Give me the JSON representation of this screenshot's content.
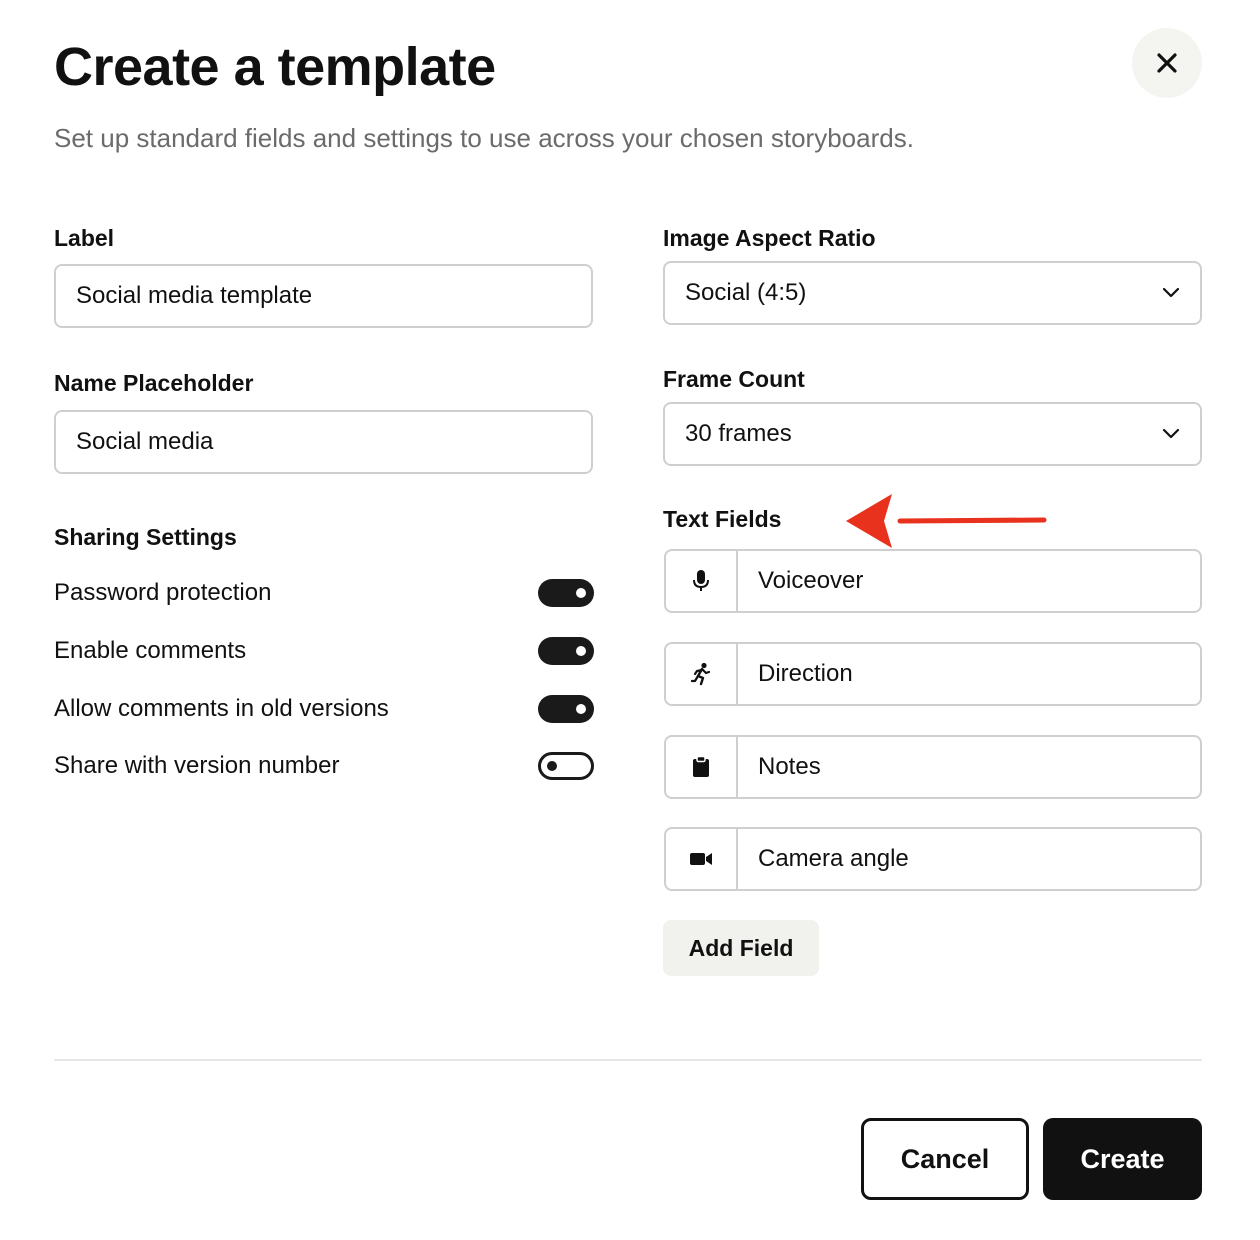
{
  "dialog": {
    "title": "Create a template",
    "subtitle": "Set up standard fields and settings to use across your chosen storyboards.",
    "close_icon": "close-icon"
  },
  "label_field": {
    "label": "Label",
    "value": "Social media template"
  },
  "name_placeholder_field": {
    "label": "Name Placeholder",
    "value": "Social media"
  },
  "aspect_ratio": {
    "label": "Image Aspect Ratio",
    "selected": "Social (4:5)"
  },
  "frame_count": {
    "label": "Frame Count",
    "selected": "30 frames"
  },
  "sharing": {
    "title": "Sharing Settings",
    "items": [
      {
        "label": "Password protection",
        "enabled": true
      },
      {
        "label": "Enable comments",
        "enabled": true
      },
      {
        "label": "Allow comments in old versions",
        "enabled": true
      },
      {
        "label": "Share with version number",
        "enabled": false
      }
    ]
  },
  "text_fields": {
    "title": "Text Fields",
    "items": [
      {
        "icon": "microphone-icon",
        "value": "Voiceover"
      },
      {
        "icon": "running-person-icon",
        "value": "Direction"
      },
      {
        "icon": "clipboard-icon",
        "value": "Notes"
      },
      {
        "icon": "video-camera-icon",
        "value": "Camera angle"
      }
    ],
    "add_label": "Add Field"
  },
  "footer": {
    "cancel_label": "Cancel",
    "create_label": "Create"
  },
  "colors": {
    "primary": "#111111",
    "subtle_bg": "#f1f1ee",
    "border": "#cfcfcf",
    "annotation_arrow": "#e8321e"
  }
}
